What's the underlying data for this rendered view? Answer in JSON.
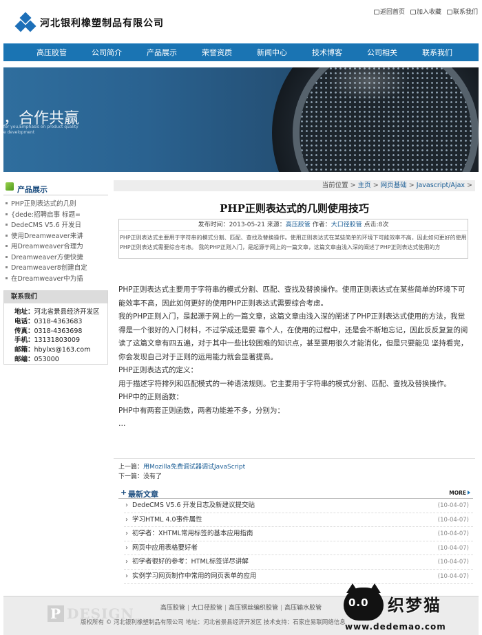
{
  "header": {
    "company_name": "河北银利橡塑制品有限公司",
    "top_links": [
      "返回首页",
      "加入收藏",
      "联系我们"
    ]
  },
  "nav": [
    "高压胶管",
    "公司简介",
    "产品展示",
    "荣誉资质",
    "新闻中心",
    "技术博客",
    "公司相关",
    "联系我们"
  ],
  "banner": {
    "slogan": "，合作共赢",
    "sub_line1": "for you,Emphasis on product quality",
    "sub_line2": "e development"
  },
  "sidebar": {
    "title": "产品展示",
    "items": [
      "PHP正则表达式的几则",
      "{dede:招聘启事 标题=",
      "DedeCMS V5.6 开发日",
      "使用Dreamweaver来讲",
      "用Dreamweaver合理为",
      "Dreamweaver方便快捷",
      "Dreamweaver8创建自定",
      "在Dreamweaver中为插"
    ],
    "contact": {
      "title": "联系我们",
      "rows": [
        {
          "k": "地址：",
          "v": "河北省景县经济开发区"
        },
        {
          "k": "电话：",
          "v": "0318-4363683"
        },
        {
          "k": "传真：",
          "v": "0318-4363698"
        },
        {
          "k": "手机：",
          "v": "13131803009"
        },
        {
          "k": "邮箱：",
          "v": "hbylxs@163.com"
        },
        {
          "k": "邮编：",
          "v": "053000"
        }
      ]
    }
  },
  "breadcrumb": {
    "prefix": "当前位置",
    "sep": " > ",
    "items": [
      "主页",
      "网页基础",
      "Javascript/Ajax"
    ],
    "suffix": " >"
  },
  "article": {
    "title": "PHP正则表达式的几则使用技巧",
    "meta_label": "发布时间：2013-05-21 来源：",
    "source": "高压胶管",
    "author_label": " 作者：",
    "author": "大口径胶管",
    "clicks": " 点击:8次",
    "summary": "PHP正则表达式主要用于字符串的模式分割、匹配、查找及替换操作。使用正则表达式在某些简单的环境下可能效率不高，因此如何更好的使用PHP正则表达式需要综合考虑。 我的PHP正则入门，是起源于网上的一篇文章，这篇文章由浅入深的阐述了PHP正则表达式使用的方",
    "paragraphs": [
      "PHP正则表达式主要用于字符串的模式分割、匹配、查找及替换操作。使用正则表达式在某些简单的环境下可能效率不高，因此如何更好的使用PHP正则表达式需要综合考虑。",
      "我的PHP正则入门，是起源于网上的一篇文章，这篇文章由浅入深的阐述了PHP正则表达式使用的方法，我觉得是一个很好的入门材料，不过学成还是要 靠个人，在使用的过程中，还是会不断地忘记，因此反反复复的阅读了这篇文章有四五遍，对于其中一些比较困难的知识点，甚至要用很久才能消化，但是只要能见 坚持看完，你会发现自己对于正则的运用能力就会显著提高。",
      "PHP正则表达式的定义：",
      "用于描述字符排列和匹配模式的一种语法规则。它主要用于字符串的模式分割、匹配、查找及替换操作。",
      "PHP中的正则函数：",
      "PHP中有两套正则函数，两者功能差不多，分别为：",
      "…"
    ],
    "prev_label": "上一篇：",
    "prev": "用Mozilla免费调试器调试JavaScript",
    "next_label": "下一篇：",
    "next": "没有了"
  },
  "latest": {
    "plus": "+",
    "title": "最新文章",
    "more": "MORE",
    "items": [
      {
        "title": "DedeCMS V5.6 开发日志及新建议提交贴",
        "date": "(10-04-07)"
      },
      {
        "title": "学习HTML 4.0事件属性",
        "date": "(10-04-07)"
      },
      {
        "title": "初学者：XHTML常用标签的基本应用指南",
        "date": "(10-04-07)"
      },
      {
        "title": "网页中应用表格要好者",
        "date": "(10-04-07)"
      },
      {
        "title": "初学者很好的参考：HTML标签详尽讲解",
        "date": "(10-04-07)"
      },
      {
        "title": "实例学习网页制作中常用的网页表单的应用",
        "date": "(10-04-07)"
      }
    ]
  },
  "footer": {
    "links": [
      "高压胶管",
      "大口径胶管",
      "高压钢丝编织胶管",
      "高压输水胶管"
    ],
    "logo_p": "P",
    "logo_text": "DESIGN",
    "copyright": "版权所有 © 河北银利橡塑制品有限公司   地址：河北省景县经济开发区   技术支持：石家庄易联网络信息"
  },
  "watermark": {
    "eyes": "0.0",
    "title": "织梦猫",
    "url": "www.dedemao.com"
  },
  "colors": {
    "nav_blue": "#1a74b3",
    "link_blue": "#1a5d95",
    "heading_blue": "#1e4f80"
  }
}
